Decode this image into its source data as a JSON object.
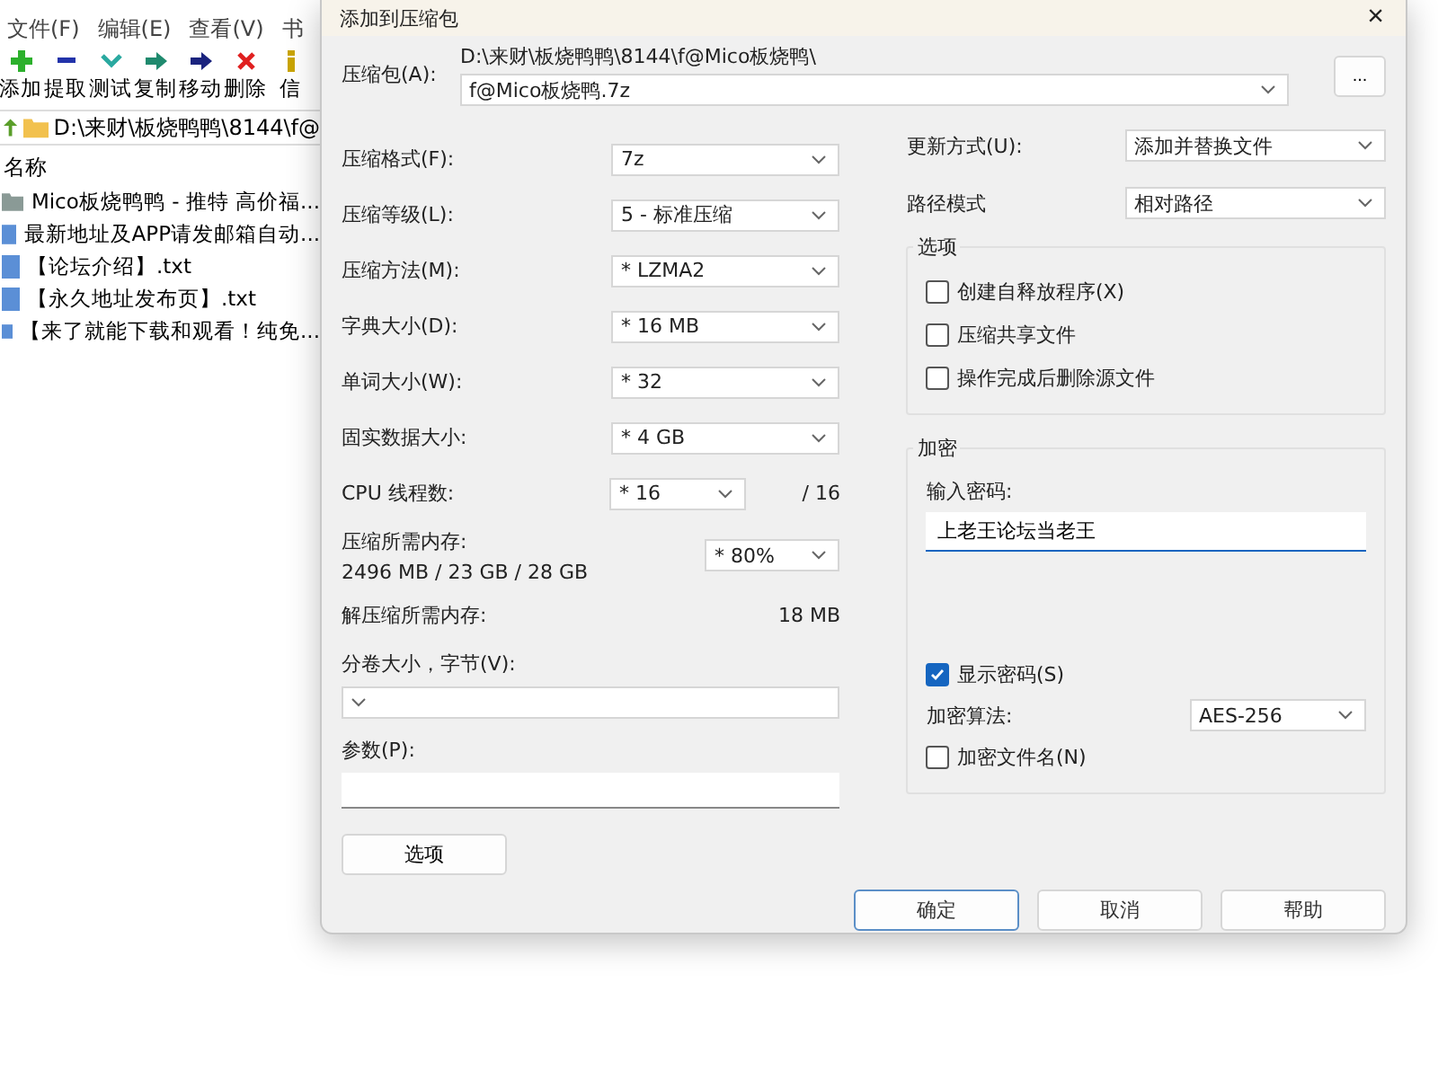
{
  "background_app": {
    "menu": [
      "文件(F)",
      "编辑(E)",
      "查看(V)",
      "书"
    ],
    "toolbar": [
      {
        "kind": "add",
        "label": "添加"
      },
      {
        "kind": "extract",
        "label": "提取"
      },
      {
        "kind": "test",
        "label": "测试"
      },
      {
        "kind": "copy",
        "label": "复制"
      },
      {
        "kind": "move",
        "label": "移动"
      },
      {
        "kind": "delete",
        "label": "删除"
      },
      {
        "kind": "info",
        "label": "信"
      }
    ],
    "address": "D:\\来财\\板烧鸭鸭\\8144\\f@",
    "column": "名称",
    "files": [
      {
        "kind": "folder",
        "name": "Mico板烧鸭鸭 - 推特 高价福..."
      },
      {
        "kind": "file",
        "name": "最新地址及APP请发邮箱自动..."
      },
      {
        "kind": "file",
        "name": "【论坛介绍】.txt"
      },
      {
        "kind": "file",
        "name": "【永久地址发布页】.txt"
      },
      {
        "kind": "file",
        "name": "【来了就能下载和观看！纯免..."
      }
    ]
  },
  "dialog": {
    "title": "添加到压缩包",
    "close": "×",
    "archive_label": "压缩包(A):",
    "archive_path": "D:\\来财\\板烧鸭鸭\\8144\\f@Mico板烧鸭\\",
    "archive_name": "f@Mico板烧鸭.7z",
    "browse": "...",
    "left_fields": [
      {
        "kind": "select",
        "label": "压缩格式(F):",
        "value": "7z"
      },
      {
        "kind": "select",
        "label": "压缩等级(L):",
        "value": "5 - 标准压缩"
      },
      {
        "kind": "select",
        "label": "压缩方法(M):",
        "value": "*  LZMA2"
      },
      {
        "kind": "select",
        "label": "字典大小(D):",
        "value": "*  16 MB"
      },
      {
        "kind": "select",
        "label": "单词大小(W):",
        "value": "*  32"
      },
      {
        "kind": "select",
        "label": "固实数据大小:",
        "value": "*  4 GB"
      },
      {
        "kind": "threads",
        "label": "CPU 线程数:",
        "value": "*  16",
        "note": "/ 16"
      },
      {
        "kind": "memory",
        "label": "压缩所需内存:",
        "reading": "2496 MB / 23 GB / 28 GB",
        "value": "* 80%"
      },
      {
        "kind": "info",
        "label": "解压缩所需内存:",
        "reading": "18 MB"
      },
      {
        "kind": "wide_select",
        "label": "分卷大小，字节(V):"
      },
      {
        "kind": "wide_input",
        "label": "参数(P):"
      }
    ],
    "options_button": "选项",
    "update_label": "更新方式(U):",
    "update_value": "添加并替换文件",
    "path_label": "路径模式",
    "path_value": "相对路径",
    "options_group": {
      "title": "选项",
      "items": [
        {
          "label": "创建自释放程序(X)",
          "checked": false
        },
        {
          "label": "压缩共享文件",
          "checked": false
        },
        {
          "label": "操作完成后删除源文件",
          "checked": false
        }
      ]
    },
    "encryption": {
      "title": "加密",
      "password_label": "输入密码:",
      "password": "上老王论坛当老王",
      "show_password": {
        "label": "显示密码(S)",
        "checked": true
      },
      "method_label": "加密算法:",
      "method": "AES-256",
      "encrypt_names": {
        "label": "加密文件名(N)",
        "checked": false
      }
    },
    "buttons": [
      {
        "label": "确定",
        "selected": true
      },
      {
        "label": "取消",
        "selected": false
      },
      {
        "label": "帮助",
        "selected": false
      }
    ]
  }
}
